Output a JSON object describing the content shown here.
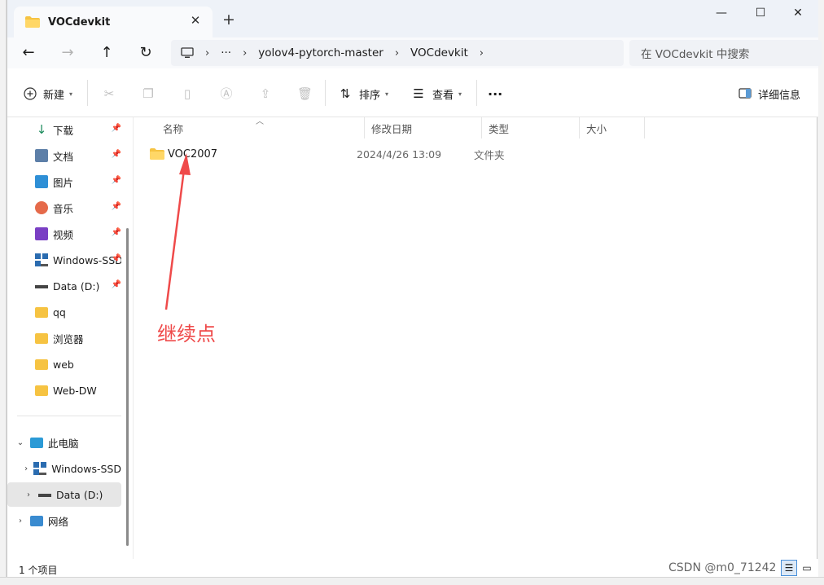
{
  "window": {
    "tab_title": "VOCdevkit",
    "new_tab": "+",
    "minimize": "—",
    "maximize": "☐",
    "close": "✕",
    "tab_close": "✕"
  },
  "nav": {
    "back": "←",
    "forward": "→",
    "up": "↑",
    "refresh": "↻",
    "more_path": "···",
    "breadcrumb": [
      "yolov4-pytorch-master",
      "VOCdevkit"
    ],
    "search_placeholder": "在 VOCdevkit 中搜索"
  },
  "toolbar": {
    "new_label": "新建",
    "sort_label": "排序",
    "view_label": "查看",
    "more_label": "···",
    "details_label": "详细信息"
  },
  "sidebar": {
    "quick": [
      {
        "label": "下载",
        "icon": "download-icon"
      },
      {
        "label": "文档",
        "icon": "document-icon"
      },
      {
        "label": "图片",
        "icon": "picture-icon"
      },
      {
        "label": "音乐",
        "icon": "music-icon"
      },
      {
        "label": "视频",
        "icon": "video-icon"
      },
      {
        "label": "Windows-SSD",
        "icon": "drive-icon"
      },
      {
        "label": "Data (D:)",
        "icon": "drive-icon"
      },
      {
        "label": "qq",
        "icon": "folder-icon"
      },
      {
        "label": "浏览器",
        "icon": "folder-icon"
      },
      {
        "label": "web",
        "icon": "folder-icon"
      },
      {
        "label": "Web-DW",
        "icon": "folder-icon"
      }
    ],
    "this_pc": "此电脑",
    "pc_children": [
      "Windows-SSD",
      "Data (D:)"
    ],
    "network": "网络"
  },
  "filelist": {
    "columns": [
      "名称",
      "修改日期",
      "类型",
      "大小"
    ],
    "rows": [
      {
        "name": "VOC2007",
        "date": "2024/4/26 13:09",
        "type": "文件夹",
        "size": ""
      }
    ]
  },
  "annotation": {
    "text": "继续点",
    "color": "#ef4a4a"
  },
  "status": {
    "item_count": "1 个项目",
    "watermark": "CSDN @m0_71242"
  },
  "colors": {
    "folder": "#f6c342",
    "accent": "#0067c0"
  }
}
